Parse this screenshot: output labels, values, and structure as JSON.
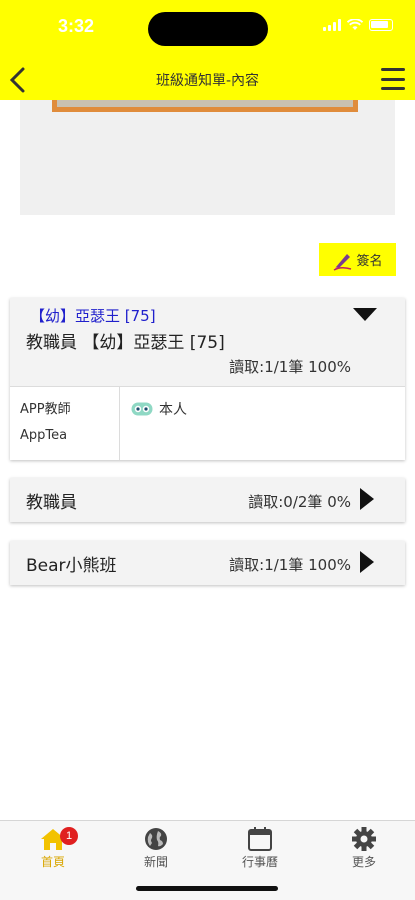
{
  "status": {
    "time": "3:32"
  },
  "header": {
    "title": "班級通知單-內容"
  },
  "sign_button": {
    "label": "簽名"
  },
  "groups": [
    {
      "subtitle": "【幼】亞瑟王 [75]",
      "title": "教職員 【幼】亞瑟王 [75]",
      "read": "讀取:1/1筆 100%",
      "expanded": true,
      "members": [
        {
          "name": "APP教師",
          "account": "AppTea",
          "status": "本人"
        }
      ]
    },
    {
      "title": "教職員",
      "read": "讀取:0/2筆 0%",
      "expanded": false
    },
    {
      "title": "Bear小熊班",
      "read": "讀取:1/1筆 100%",
      "expanded": false
    }
  ],
  "tabbar": {
    "tabs": [
      {
        "label": "首頁",
        "icon": "home-icon",
        "badge": "1",
        "active": true
      },
      {
        "label": "新聞",
        "icon": "globe-icon"
      },
      {
        "label": "行事曆",
        "icon": "calendar-icon"
      },
      {
        "label": "更多",
        "icon": "gear-icon"
      }
    ]
  },
  "colors": {
    "header_bg": "#ffff00",
    "accent_blue": "#2020cc",
    "badge_red": "#e02020"
  }
}
